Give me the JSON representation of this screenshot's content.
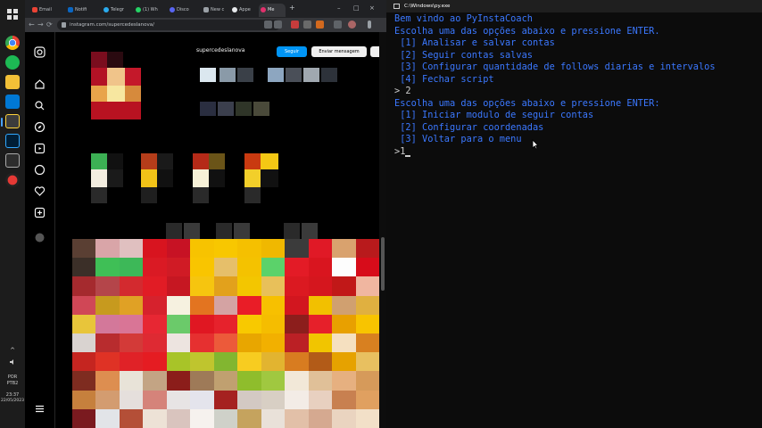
{
  "browser": {
    "tabs": [
      {
        "label": "Email",
        "favicon": "#ea4335"
      },
      {
        "label": "Notifi",
        "favicon": "#0a66c2"
      },
      {
        "label": "Telegr",
        "favicon": "#2aabee"
      },
      {
        "label": "(1) Wh",
        "favicon": "#25d366"
      },
      {
        "label": "Disco",
        "favicon": "#5865f2"
      },
      {
        "label": "New c",
        "favicon": "#9aa0a6"
      },
      {
        "label": "Appe",
        "favicon": "#e8eaed"
      },
      {
        "label": "Me",
        "favicon": "#e1306c",
        "active": true
      }
    ],
    "new_tab": "+",
    "url": "instagram.com/supercedeslanova/",
    "nav": {
      "back": "←",
      "forward": "→",
      "reload": "⟳"
    },
    "window_controls": {
      "minimize": "–",
      "maximize": "□",
      "close": "×"
    }
  },
  "instagram": {
    "follow_label": "Seguir",
    "message_label": "Enviar mensagem",
    "username": "supercedeslanova"
  },
  "taskbar": {
    "lang_top": "POR",
    "lang_bottom": "PTB2",
    "time": "23:37",
    "date": "22/05/2023",
    "up_arrow": "^"
  },
  "console": {
    "window_title": "C:\\Windows\\py.exe",
    "lines": [
      {
        "text": "Bem vindo ao PyInstaCoach",
        "color": "blue"
      },
      {
        "text": "Escolha uma das opções abaixo e pressione ENTER.",
        "color": "blue"
      },
      {
        "text": " [1] Analisar e salvar contas",
        "color": "blue"
      },
      {
        "text": " [2] Seguir contas salvas",
        "color": "blue"
      },
      {
        "text": " [3] Configurar quantidade de follows diarias e intervalos",
        "color": "blue"
      },
      {
        "text": " [4] Fechar script",
        "color": "blue"
      },
      {
        "text": "> 2",
        "color": "white"
      },
      {
        "text": "Escolha uma das opções abaixo e pressione ENTER:",
        "color": "blue"
      },
      {
        "text": " [1] Iniciar modulo de seguir contas",
        "color": "blue"
      },
      {
        "text": " [2] Configurar coordenadas",
        "color": "blue"
      },
      {
        "text": " [3] Voltar para o menu",
        "color": "blue"
      },
      {
        "text": ">1",
        "color": "white"
      }
    ]
  }
}
